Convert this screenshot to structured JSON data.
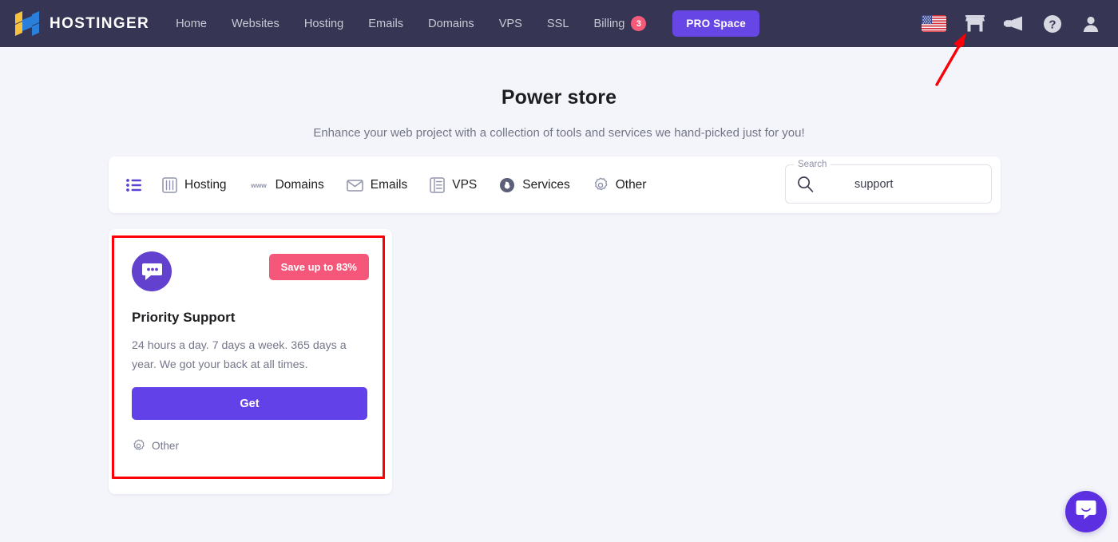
{
  "topnav": {
    "brand_text": "HOSTINGER",
    "brand_logo_icon": "hostinger-h-logo",
    "links": [
      {
        "label": "Home"
      },
      {
        "label": "Websites"
      },
      {
        "label": "Hosting"
      },
      {
        "label": "Emails"
      },
      {
        "label": "Domains"
      },
      {
        "label": "VPS"
      },
      {
        "label": "SSL"
      },
      {
        "label": "Billing",
        "badge": "3"
      }
    ],
    "pro_space_label": "PRO Space",
    "right_icons": [
      {
        "name": "us-flag-icon",
        "label": "United States flag"
      },
      {
        "name": "store-icon",
        "label": "Power store"
      },
      {
        "name": "megaphone-icon",
        "label": "Announcements"
      },
      {
        "name": "help-icon",
        "label": "Help"
      },
      {
        "name": "account-icon",
        "label": "Account"
      }
    ],
    "colors": {
      "bar_bg": "#363553",
      "badge": "#f45b7a",
      "pro_button": "#6746e6"
    }
  },
  "page": {
    "title": "Power store",
    "subtitle": "Enhance your web project with a collection of tools and services we hand-picked just for you!"
  },
  "filterbar": {
    "list_toggle_icon": "list-view-icon",
    "items": [
      {
        "label": "Hosting",
        "icon": "server-icon"
      },
      {
        "label": "Domains",
        "icon": "www-icon"
      },
      {
        "label": "Emails",
        "icon": "envelope-icon"
      },
      {
        "label": "VPS",
        "icon": "vps-server-icon"
      },
      {
        "label": "Services",
        "icon": "services-badge-icon"
      },
      {
        "label": "Other",
        "icon": "gear-icon"
      }
    ],
    "search": {
      "legend": "Search",
      "value": "support",
      "placeholder": "Search",
      "icon": "search-icon"
    }
  },
  "cards": [
    {
      "avatar_icon": "chat-bubble-icon",
      "badge": "Save up to 83%",
      "title": "Priority Support",
      "description": "24 hours a day. 7 days a week. 365 days a year. We got your back at all times.",
      "cta": "Get",
      "tag": "Other",
      "tag_icon": "gear-icon",
      "colors": {
        "avatar": "#6341cf",
        "badge": "#f4577a",
        "cta": "#6341e8"
      }
    }
  ],
  "annotation": {
    "arrow_icon": "red-arrow-icon",
    "arrow_color": "#fb0007",
    "highlight_color": "#fb0007"
  },
  "intercom": {
    "icon": "intercom-chat-icon",
    "color": "#5c2fe0"
  }
}
